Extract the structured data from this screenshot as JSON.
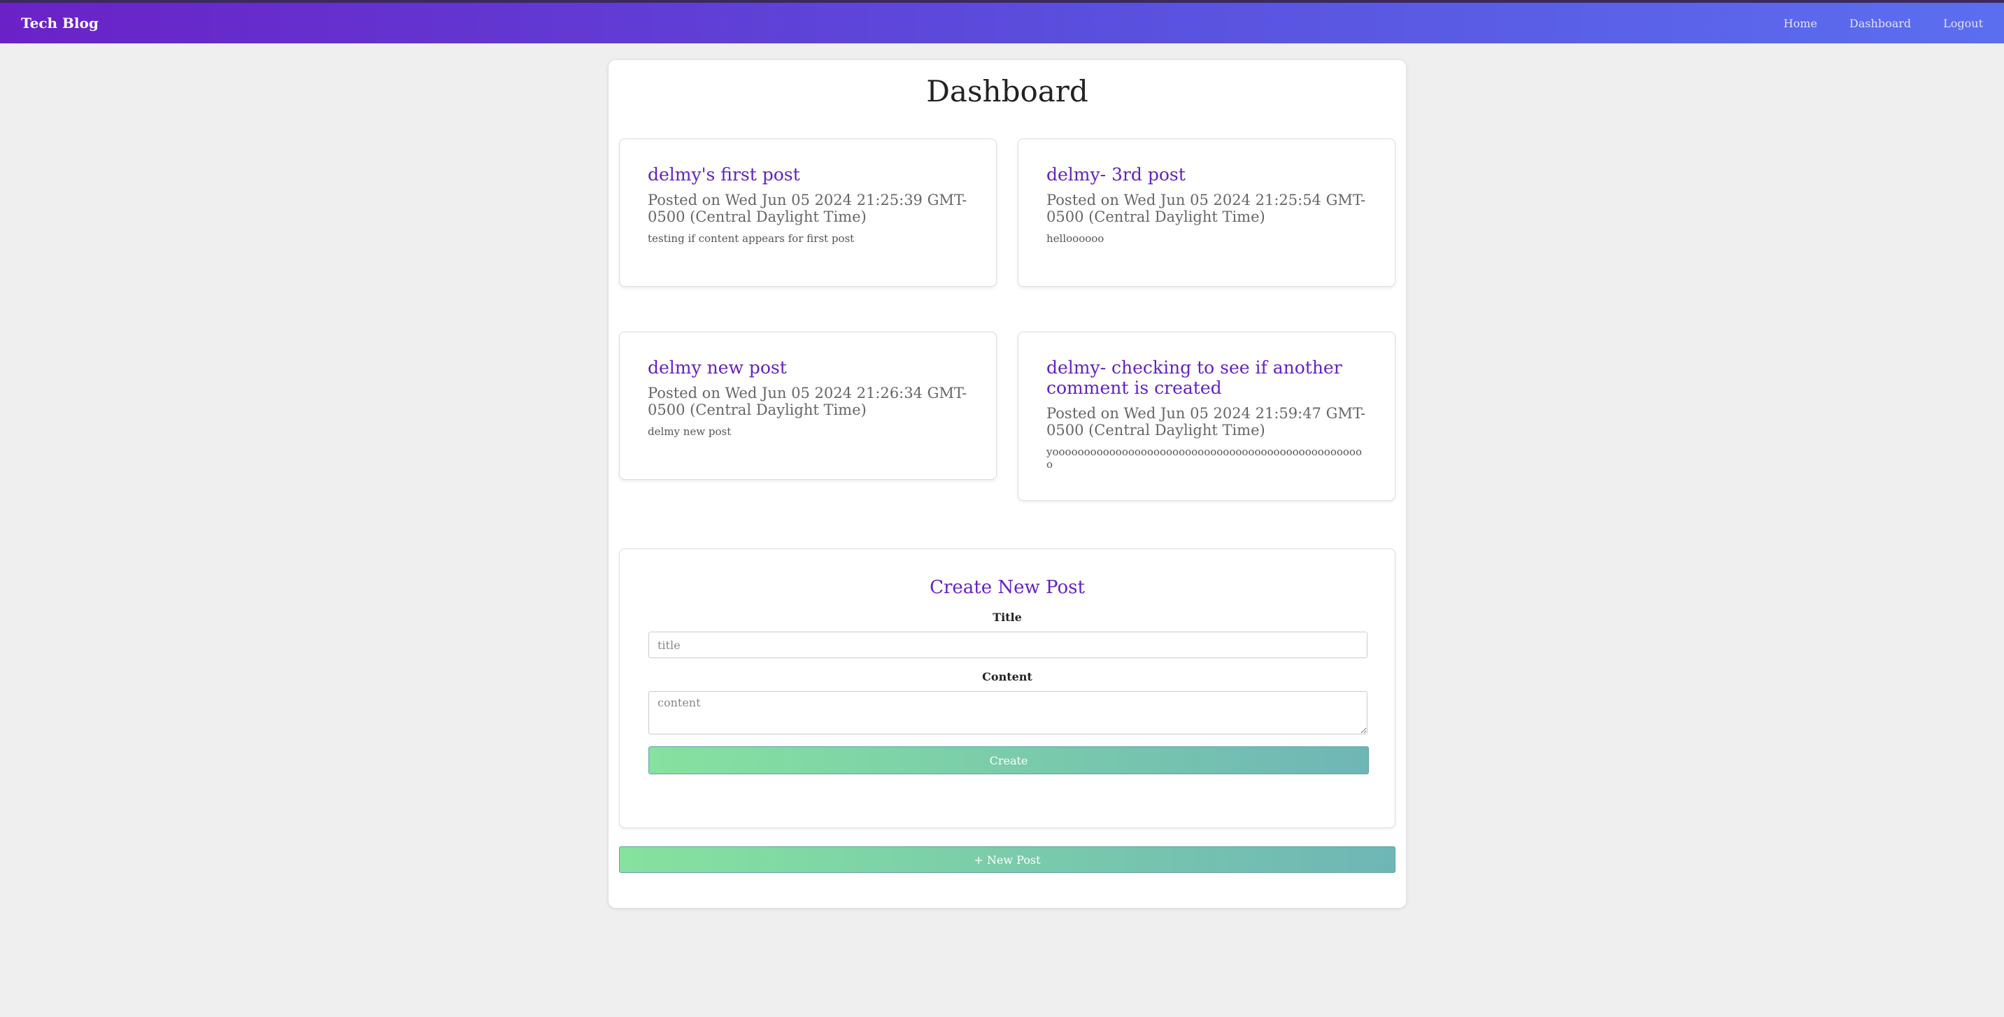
{
  "navbar": {
    "brand": "Tech Blog",
    "links": [
      "Home",
      "Dashboard",
      "Logout"
    ]
  },
  "page": {
    "title": "Dashboard"
  },
  "posts": [
    {
      "title": "delmy's first post",
      "meta": "Posted on Wed Jun 05 2024 21:25:39 GMT-0500 (Central Daylight Time)",
      "content": "testing if content appears for first post"
    },
    {
      "title": "delmy- 3rd post",
      "meta": "Posted on Wed Jun 05 2024 21:25:54 GMT-0500 (Central Daylight Time)",
      "content": "helloooooo"
    },
    {
      "title": "delmy new post",
      "meta": "Posted on Wed Jun 05 2024 21:26:34 GMT-0500 (Central Daylight Time)",
      "content": "delmy new post"
    },
    {
      "title": "delmy- checking to see if another comment is created",
      "meta": "Posted on Wed Jun 05 2024 21:59:47 GMT-0500 (Central Daylight Time)",
      "content": "yoooooooooooooooooooooooooooooooooooooooooooooooooo"
    }
  ],
  "create_form": {
    "heading": "Create New Post",
    "title_label": "Title",
    "title_placeholder": "title",
    "content_label": "Content",
    "content_placeholder": "content",
    "submit_label": "Create"
  },
  "new_post_button": "+ New Post",
  "colors": {
    "accent": "#6322c2",
    "navbar_start": "#6a22c6",
    "navbar_end": "#5b6ef0",
    "button_start": "#86e29f",
    "button_end": "#6fb6b6"
  }
}
